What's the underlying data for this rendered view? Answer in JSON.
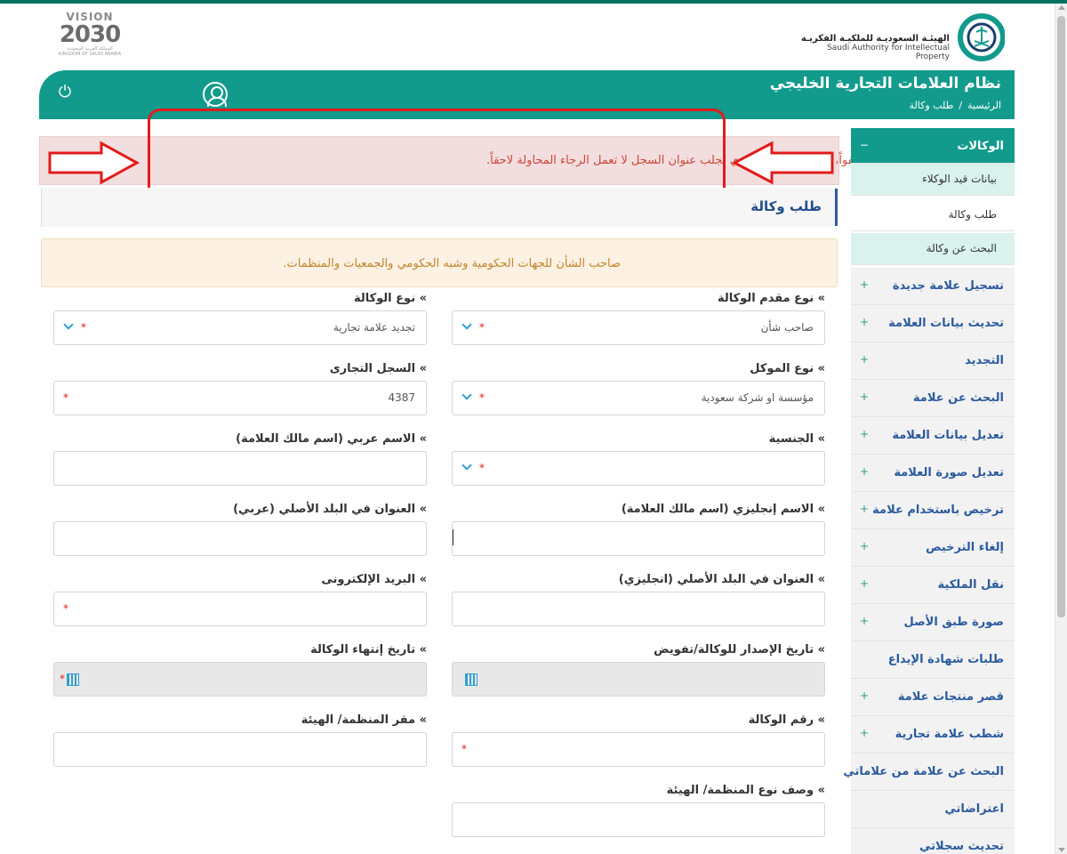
{
  "header": {
    "vision": {
      "top": "VISION",
      "year": "2030",
      "sub_ar": "المملكة العربية السعودية",
      "sub_en": "KINGDOM OF SAUDI ARABIA"
    },
    "authority_ar": "الهيئـة السعوديـة للملكيـة الفكريـة",
    "authority_en": "Saudi Authority for Intellectual Property",
    "system_title": "نظام العلامات التجارية الخليجي",
    "breadcrumb": {
      "home": "الرئيسية",
      "sep": "/",
      "current": "طلب وكالة"
    }
  },
  "alerts": {
    "error": "عفواً، خدمة البريد السعودي لجلب عنوان السجل لا تعمل الرجاء المحاولة لاحقاً.",
    "warning": "صاحب الشأن للجهات الحكومية وشبه الحكومي والجمعيات والمنظمات."
  },
  "page_title": "طلب وكالة",
  "form": {
    "applicant_type": {
      "label": "» نوع مقدم الوكالة",
      "value": "صاحب شأن"
    },
    "agency_type": {
      "label": "» نوع الوكالة",
      "value": "تجديد علامة تجارية"
    },
    "principal_type": {
      "label": "» نوع الموكل",
      "value": "مؤسسة او شركة سعودية"
    },
    "commercial_register": {
      "label": "» السجل التجارى",
      "value": "4387"
    },
    "nationality": {
      "label": "» الجنسية",
      "value": ""
    },
    "arabic_name": {
      "label": "» الاسم عربي (اسم مالك العلامة)",
      "value": ""
    },
    "english_name": {
      "label": "» الاسم إنجليزي (اسم مالك العلامة)",
      "value": ""
    },
    "origin_address_ar": {
      "label": "» العنوان في البلد الأصلي (عربي)",
      "value": ""
    },
    "origin_address_en": {
      "label": "» العنوان في البلد الأصلي (انجليزي)",
      "value": ""
    },
    "email": {
      "label": "» البريد الإلكترونى",
      "value": ""
    },
    "issue_date": {
      "label": "» تاريخ الإصدار للوكالة/تفويض",
      "value": ""
    },
    "expiry_date": {
      "label": "» تاريخ إنتهاء الوكالة",
      "value": ""
    },
    "agency_number": {
      "label": "» رقم الوكالة",
      "value": ""
    },
    "org_hq": {
      "label": "» مقر المنظمة/ الهيئة",
      "value": ""
    },
    "org_type_desc": {
      "label": "» وصف نوع المنظمة/ الهيئة",
      "value": ""
    },
    "required_mark": "*"
  },
  "sidebar": {
    "group_title": "الوكالات",
    "collapse_symbol": "−",
    "expand_symbol": "+",
    "sub_items": [
      "بيانات قيد الوكلاء",
      "طلب وكالة",
      "البحث عن وكالة"
    ],
    "items": [
      "تسجيل علامة جديدة",
      "تحديث بيانات العلامة",
      "التجديد",
      "البحث عن علامة",
      "تعديل بيانات العلامة",
      "تعديل صورة العلامة",
      "ترخيص باستخدام علامة",
      "إلغاء الترخيص",
      "نقل الملكية",
      "صورة طبق الأصل",
      "طلبات شهادة الإيداع",
      "قصر منتجات علامة",
      "شطب علامة تجارية",
      "البحث عن علامة من علاماتي",
      "اعتراضاتي",
      "تحديث سجلاتي"
    ]
  },
  "colors": {
    "brand_green": "#129b8c",
    "alert_red": "#e21b1b",
    "link_blue": "#2a5aa0"
  }
}
